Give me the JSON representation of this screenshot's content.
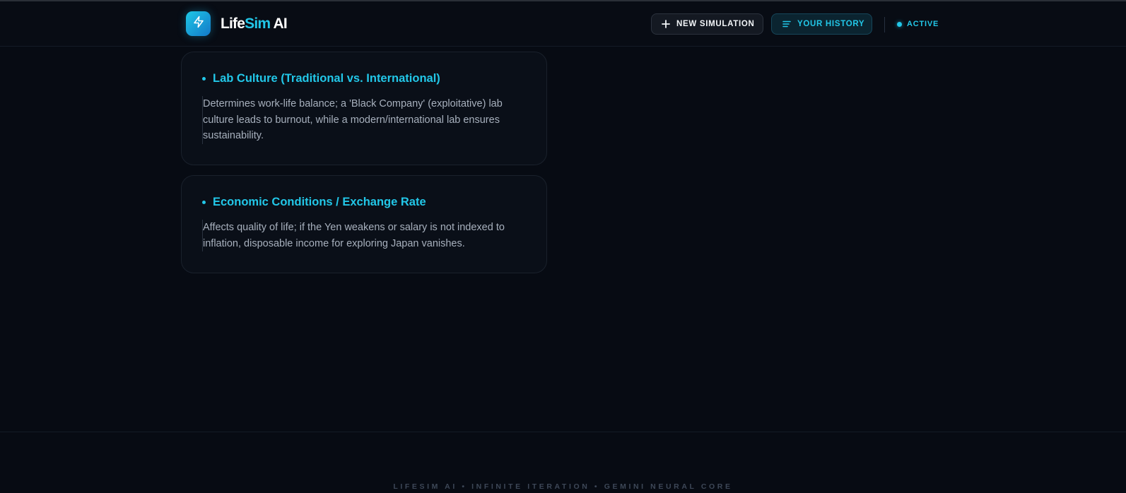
{
  "header": {
    "brand": {
      "part1": "Life",
      "part2": "Sim",
      "part3": " AI"
    },
    "logo_icon": "lightning-bolt-icon",
    "new_simulation_label": "NEW SIMULATION",
    "history_label": "YOUR HISTORY",
    "status_label": "ACTIVE"
  },
  "cards": [
    {
      "title": "Lab Culture (Traditional vs. International)",
      "text": "Determines work-life balance; a 'Black Company' (exploitative) lab culture leads to burnout, while a modern/international lab ensures sustainability."
    },
    {
      "title": "Economic Conditions / Exchange Rate",
      "text": "Affects quality of life; if the Yen weakens or salary is not indexed to inflation, disposable income for exploring Japan vanishes."
    }
  ],
  "footer": {
    "text": "LIFESIM AI • INFINITE ITERATION • GEMINI NEURAL CORE"
  },
  "colors": {
    "accent": "#22c7e8",
    "background": "#070b13",
    "card": "#0a0f18"
  }
}
